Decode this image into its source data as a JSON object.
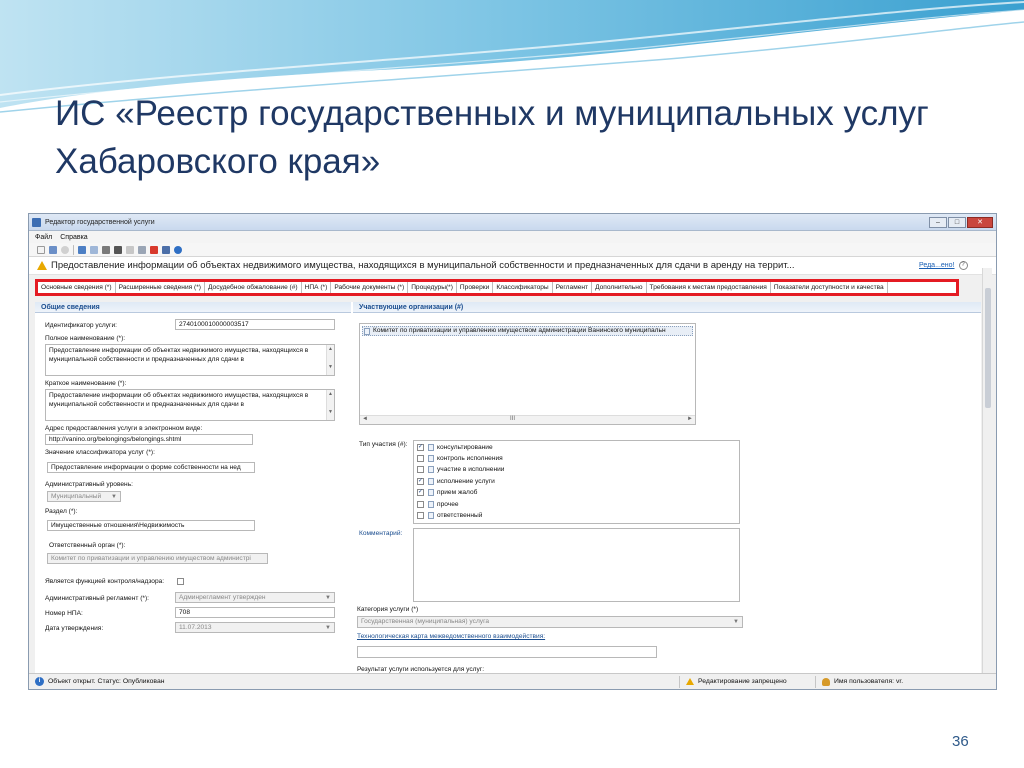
{
  "slide": {
    "title_line1": "ИС «Реестр государственных и муниципальных услуг",
    "title_line2": "Хабаровского края»",
    "page_number": "36"
  },
  "window": {
    "title": "Редактор государственной услуги",
    "controls": [
      "–",
      "□",
      "✕"
    ]
  },
  "menu": [
    "Файл",
    "Справка"
  ],
  "document": {
    "title": "Предоставление информации об объектах недвижимого имущества, находящихся в муниципальной собственности и предназначенных для сдачи в аренду на террит...",
    "edit_link": "Реда...ено!"
  },
  "tabs": [
    "Основные сведения (*)",
    "Расширенные сведения (*)",
    "Досудебное обжалование (#)",
    "НПА (*)",
    "Рабочие документы (*)",
    "Процедуры(*)",
    "Проверки",
    "Классификаторы",
    "Регламент",
    "Дополнительно",
    "Требования к местам предоставления",
    "Показатели доступности и качества"
  ],
  "general": {
    "section_title": "Общие сведения",
    "id_label": "Идентификатор услуги:",
    "id_value": "2740100010000003517",
    "full_name_label": "Полное наименование (*):",
    "full_name_value": "Предоставление информации об объектах недвижимого имущества, находящихся в муниципальной собственности и предназначенных для сдачи в",
    "short_name_label": "Краткое наименование (*):",
    "short_name_value": "Предоставление информации об объектах недвижимого имущества, находящихся в муниципальной собственности и предназначенных для сдачи в",
    "url_label": "Адрес предоставления услуги в электронном виде:",
    "url_value": "http://vanino.org/belongings/belongings.shtml",
    "classifier_label": "Значение классификатора услуг (*):",
    "classifier_value": "Предоставление информации о форме собственности на нед",
    "admin_level_label": "Административный уровень:",
    "admin_level_value": "Муниципальный",
    "section_label": "Раздел (*):",
    "section_value": "Имущественные отношения\\Недвижимость",
    "responsible_label": "Ответственный орган (*):",
    "responsible_value": "Комитет по приватизации и управлению имуществом администрі",
    "control_label": "Является функцией контроля/надзора:",
    "reglament_label": "Административный регламент (*):",
    "reglament_value": "Админрегламент утвержден",
    "npa_label": "Номер НПА:",
    "npa_value": "708",
    "date_label": "Дата утверждения:",
    "date_value": "11.07.2013"
  },
  "participants": {
    "section_title": "Участвующие организации (#)",
    "org": "Комитет по приватизации и управлению имуществом администрации Ванинского муниципальн",
    "type_label": "Тип участия (#):",
    "types": [
      {
        "label": "консультирование",
        "checked": true
      },
      {
        "label": "контроль исполнения",
        "checked": false
      },
      {
        "label": "участие в исполнении",
        "checked": false
      },
      {
        "label": "исполнение услуги",
        "checked": true
      },
      {
        "label": "прием жалоб",
        "checked": true
      },
      {
        "label": "прочее",
        "checked": false
      },
      {
        "label": "ответственный",
        "checked": false
      }
    ],
    "comment_label": "Комментарий:",
    "category_label": "Категория услуги (*)",
    "category_value": "Государственная (муниципальная) услуга",
    "techmap_link": "Технологическая карта межведомственного взаимодействия:",
    "result_label": "Результат услуги используется для услуг:"
  },
  "status": {
    "opened": "Объект открыт. Статус: Опубликован",
    "edit_forbidden": "Редактирование запрещено",
    "user": "Имя пользователя: vr."
  }
}
